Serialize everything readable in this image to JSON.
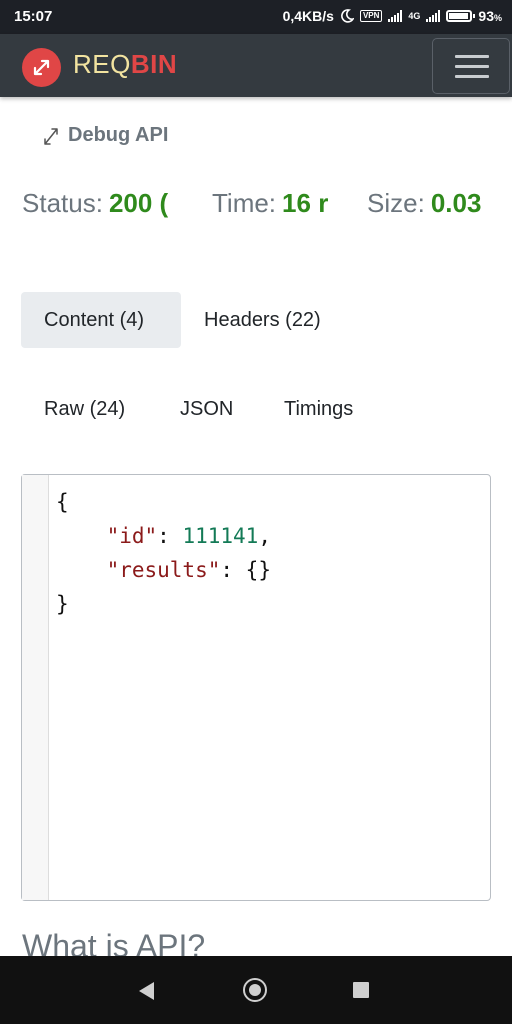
{
  "status_bar": {
    "time": "15:07",
    "network_speed": "0,4KB/s",
    "vpn_label": "VPN",
    "network_type": "4G",
    "battery_percent": "93",
    "battery_unit": "%",
    "battery_level": 0.93
  },
  "navbar": {
    "brand_req": "REQ",
    "brand_bin": "BIN",
    "logo_icon": "arrows-diagonal-icon",
    "menu_icon": "hamburger-icon"
  },
  "debug_link": {
    "label": "Debug API",
    "icon": "arrows-diagonal-icon"
  },
  "response_stats": {
    "status_label": "Status:",
    "status_value": "200 (",
    "time_label": "Time:",
    "time_value": "16 r",
    "size_label": "Size:",
    "size_value": "0.03"
  },
  "response_tabs": [
    {
      "label": "Content (4)",
      "active": true
    },
    {
      "label": "Headers (22)",
      "active": false
    }
  ],
  "content_tabs": [
    {
      "label": "Raw (24)"
    },
    {
      "label": "JSON"
    },
    {
      "label": "Timings"
    }
  ],
  "code_view": {
    "open_brace": "{",
    "id_key": "\"id\"",
    "id_colon": ": ",
    "id_value": "111141",
    "id_comma": ",",
    "results_key": "\"results\"",
    "results_colon": ": ",
    "results_value": "{}",
    "close_brace": "}"
  },
  "section_heading": "What is API?",
  "colors": {
    "navbar_bg": "#343a40",
    "brand_accent": "#e04646",
    "brand_text": "#f2e3a0",
    "status_value": "#2f8a1c",
    "json_key": "#8b1a1a",
    "json_number": "#137a56"
  }
}
